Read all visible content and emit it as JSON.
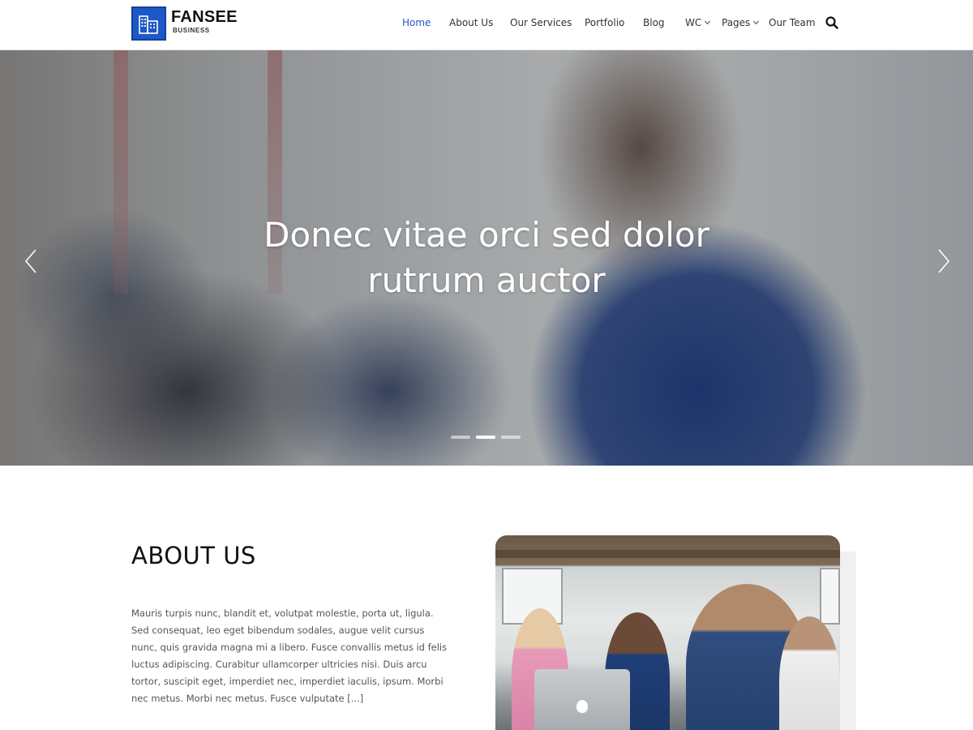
{
  "header": {
    "logo_name": "FANSEE",
    "logo_tagline": "BUSINESS",
    "nav": [
      {
        "label": "Home",
        "active": true
      },
      {
        "label": "About Us",
        "active": false
      },
      {
        "label": "Our Services",
        "active": false
      },
      {
        "label": "Portfolio",
        "active": false
      },
      {
        "label": "Blog",
        "active": false
      },
      {
        "label": "WC",
        "active": false,
        "dropdown": true
      },
      {
        "label": "Pages",
        "active": false,
        "dropdown": true
      },
      {
        "label": "Our Team",
        "active": false
      }
    ],
    "search_icon": "search-icon"
  },
  "hero": {
    "title_line1": "Donec vitae orci sed dolor",
    "title_line2": "rutrum auctor",
    "prev_icon": "chevron-left-icon",
    "next_icon": "chevron-right-icon",
    "slides_total": 3,
    "active_slide": 2
  },
  "about": {
    "title": "ABOUT US",
    "text": "Mauris turpis nunc, blandit et, volutpat molestie, porta ut, ligula. Sed consequat, leo eget bibendum sodales, augue velit cursus nunc, quis gravida magna mi a libero. Fusce convallis metus id felis luctus adipiscing. Curabitur ullamcorper ultricies nisi. Duis arcu tortor, suscipit eget, imperdiet nec, imperdiet iaculis, ipsum. Morbi nec metus. Morbi nec metus. Fusce vulputate [...]"
  },
  "colors": {
    "accent": "#1c58c7",
    "text_dark": "#111111",
    "text_body": "#555555"
  }
}
